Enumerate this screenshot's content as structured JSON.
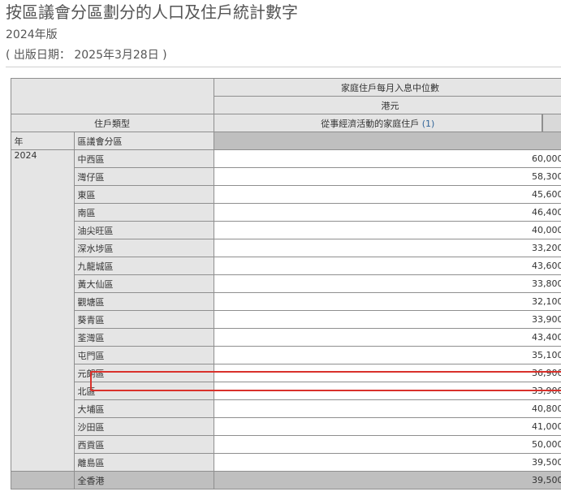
{
  "page": {
    "title": "按區議會分區劃分的人口及住戶統計數字",
    "subtitle": "2024年版",
    "publish_date": "( 出版日期： 2025年3月28日 )"
  },
  "table": {
    "header_measure": "家庭住戶每月入息中位數",
    "header_unit": "港元",
    "header_household_type_label": "住戶類型",
    "header_household_type_value": "從事經濟活動的家庭住戶",
    "header_footnote": "(1)",
    "col_year": "年",
    "col_district": "區議會分區",
    "year": "2024",
    "rows": [
      {
        "district": "中西區",
        "value": "60,000"
      },
      {
        "district": "灣仔區",
        "value": "58,300"
      },
      {
        "district": "東區",
        "value": "45,600"
      },
      {
        "district": "南區",
        "value": "46,400"
      },
      {
        "district": "油尖旺區",
        "value": "40,000"
      },
      {
        "district": "深水埗區",
        "value": "33,200"
      },
      {
        "district": "九龍城區",
        "value": "43,600"
      },
      {
        "district": "黃大仙區",
        "value": "33,800"
      },
      {
        "district": "觀塘區",
        "value": "32,100"
      },
      {
        "district": "葵青區",
        "value": "33,900"
      },
      {
        "district": "荃灣區",
        "value": "43,400"
      },
      {
        "district": "屯門區",
        "value": "35,100"
      },
      {
        "district": "元朗區",
        "value": "36,900"
      },
      {
        "district": "北區",
        "value": "33,900"
      },
      {
        "district": "大埔區",
        "value": "40,800"
      },
      {
        "district": "沙田區",
        "value": "41,000"
      },
      {
        "district": "西貢區",
        "value": "50,000"
      },
      {
        "district": "離島區",
        "value": "39,500"
      }
    ],
    "total": {
      "district": "全香港",
      "value": "39,500"
    },
    "highlight_color": "#d9312b"
  }
}
